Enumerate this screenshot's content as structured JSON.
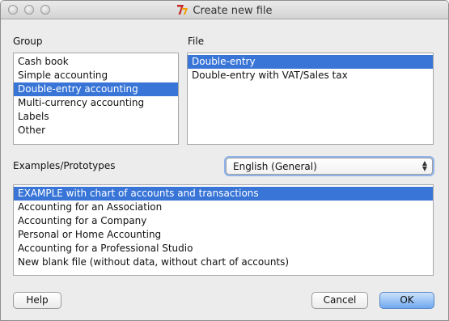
{
  "window": {
    "title": "Create new file"
  },
  "group": {
    "label": "Group",
    "items": [
      "Cash book",
      "Simple accounting",
      "Double-entry accounting",
      "Multi-currency accounting",
      "Labels",
      "Other"
    ],
    "selected_index": 2
  },
  "file": {
    "label": "File",
    "items": [
      "Double-entry",
      "Double-entry with VAT/Sales tax"
    ],
    "selected_index": 0
  },
  "examples": {
    "label": "Examples/Prototypes",
    "language_select": "English (General)",
    "items": [
      "EXAMPLE with chart of accounts and transactions",
      "Accounting for an Association",
      "Accounting for a Company",
      "Personal or Home Accounting",
      "Accounting for a Professional Studio",
      "New blank file (without data, without chart of accounts)"
    ],
    "selected_index": 0
  },
  "buttons": {
    "help": "Help",
    "cancel": "Cancel",
    "ok": "OK"
  },
  "colors": {
    "selection": "#3875d7",
    "window_bg": "#ececec"
  }
}
